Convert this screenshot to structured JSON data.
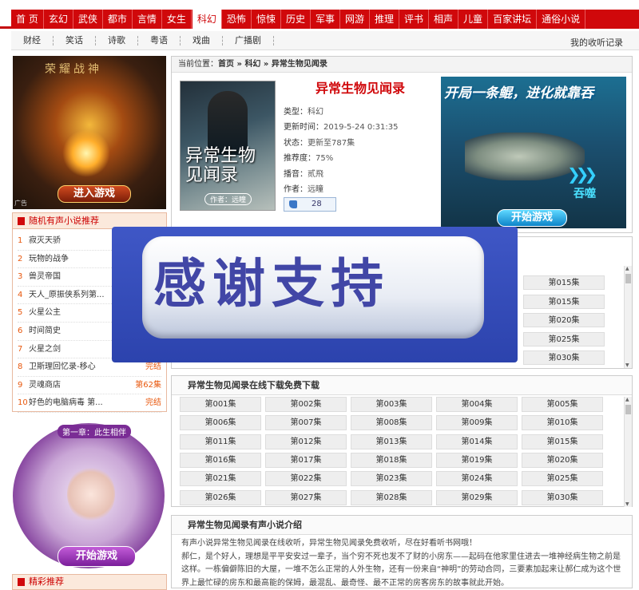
{
  "nav": {
    "items": [
      "首 页",
      "玄幻",
      "武侠",
      "都市",
      "言情",
      "女生",
      "科幻",
      "恐怖",
      "惊悚",
      "历史",
      "军事",
      "网游",
      "推理",
      "评书",
      "相声",
      "儿童",
      "百家讲坛",
      "通俗小说"
    ],
    "active_index": 6
  },
  "subnav": {
    "items": [
      "财经",
      "笑话",
      "诗歌",
      "粤语",
      "戏曲",
      "广播剧"
    ],
    "history": "我的收听记录"
  },
  "left_ad": {
    "title": "荣耀战神",
    "button": "进入游戏",
    "tag": "广告"
  },
  "random_rec": {
    "title": "随机有声小说推荐",
    "items": [
      {
        "n": "1",
        "name": "寂灭天骄",
        "status": ""
      },
      {
        "n": "2",
        "name": "玩物的战争",
        "status": ""
      },
      {
        "n": "3",
        "name": "兽灵帝国",
        "status": ""
      },
      {
        "n": "4",
        "name": "天人_原振侠系列第...",
        "status": ""
      },
      {
        "n": "5",
        "name": "火星公主",
        "status": ""
      },
      {
        "n": "6",
        "name": "时间简史",
        "status": ""
      },
      {
        "n": "7",
        "name": "火星之剑",
        "status": ""
      },
      {
        "n": "8",
        "name": "卫斯理回忆录-移心",
        "status": "完结"
      },
      {
        "n": "9",
        "name": "灵魂商店",
        "status": "第62集"
      },
      {
        "n": "10",
        "name": "好色的电脑病毒 第...",
        "status": "完结"
      }
    ]
  },
  "left_ad2": {
    "chapter": "第一章：此生相伴",
    "button": "开始游戏"
  },
  "jingcai": "精彩推荐",
  "breadcrumb": {
    "prefix": "当前位置：",
    "home": "首页",
    "sep": "»",
    "cat": "科幻",
    "book": "异常生物见闻录"
  },
  "book": {
    "title": "异常生物见闻录",
    "cover_title": "异常生物见闻录",
    "cover_author": "作者：远瞳",
    "type_k": "类型：",
    "type_v": "科幻",
    "time_k": "更新时间：",
    "time_v": "2019-5-24 0:31:35",
    "state_k": "状态：",
    "state_v": "更新至787集",
    "rate_k": "推荐度：",
    "rate_v": "75%",
    "narrator_k": "播音：",
    "narrator_v": "贰飛",
    "author_k": "作者：",
    "author_v": "远瞳",
    "likes": "28"
  },
  "right_ad": {
    "slogan": "开局一条鲲，进化就靠吞",
    "arrows": "❯❯❯",
    "label": "吞噬",
    "button": "开始游戏"
  },
  "playlist_partial": [
    "第015集",
    "第015集",
    "第020集",
    "第025集",
    "第030集"
  ],
  "thanks": "感谢支持",
  "download": {
    "title": "异常生物见闻录在线下载免费下载",
    "episodes": [
      "第001集",
      "第002集",
      "第003集",
      "第004集",
      "第005集",
      "第006集",
      "第007集",
      "第008集",
      "第009集",
      "第010集",
      "第011集",
      "第012集",
      "第013集",
      "第014集",
      "第015集",
      "第016集",
      "第017集",
      "第018集",
      "第019集",
      "第020集",
      "第021集",
      "第022集",
      "第023集",
      "第024集",
      "第025集",
      "第026集",
      "第027集",
      "第028集",
      "第029集",
      "第030集"
    ]
  },
  "intro": {
    "title": "异常生物见闻录有声小说介绍",
    "p1": "有声小说异常生物见闻录在线收听，异常生物见闻录免费收听，尽在好看听书网哦！",
    "p2": "郝仁，是个好人，理想是平平安安过一辈子，当个穷不死也发不了财的小房东——起码在他家里住进去一堆神经病生物之前是这样。一栋偏僻陈旧的大屋，一堆不怎么正常的人外生物，还有一份来自“神明”的劳动合同，三要素加起来让郝仁成为这个世界上最忙碌的房东和最高能的保姆，最混乱、最奇怪、最不正常的房客房东的故事就此开始。"
  }
}
